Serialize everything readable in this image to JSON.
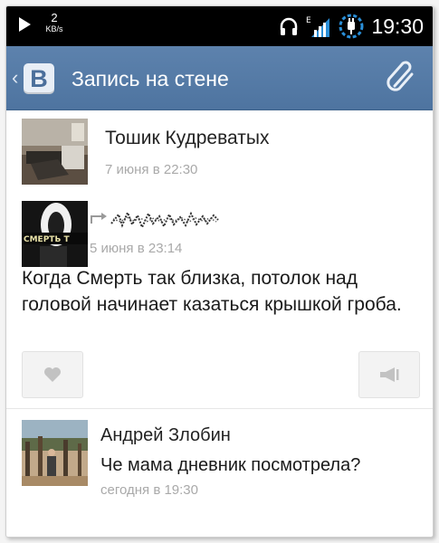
{
  "status_bar": {
    "net_speed_value": "2",
    "net_speed_unit": "KB/s",
    "time": "19:30",
    "icons": [
      "play-icon",
      "headphones-icon",
      "signal-icon",
      "usb-icon"
    ]
  },
  "header": {
    "logo_letter": "B",
    "title": "Запись на стене",
    "attach_icon": "paperclip-icon",
    "color": "#5a7fab"
  },
  "post_author": {
    "name": "Тошик Кудреватых",
    "date": "7 июня в 22:30"
  },
  "repost": {
    "avatar_caption": "СМЕРТЬ Т",
    "date": "5 июня в 23:14",
    "text": "Когда Смерть так близка, потолок над головой начинает казаться крышкой гроба."
  },
  "actions": {
    "like_icon": "heart-icon",
    "share_icon": "megaphone-icon"
  },
  "comment": {
    "author": "Андрей Злобин",
    "text": "Че мама дневник посмотрела?",
    "date": "сегодня в 19:30"
  }
}
